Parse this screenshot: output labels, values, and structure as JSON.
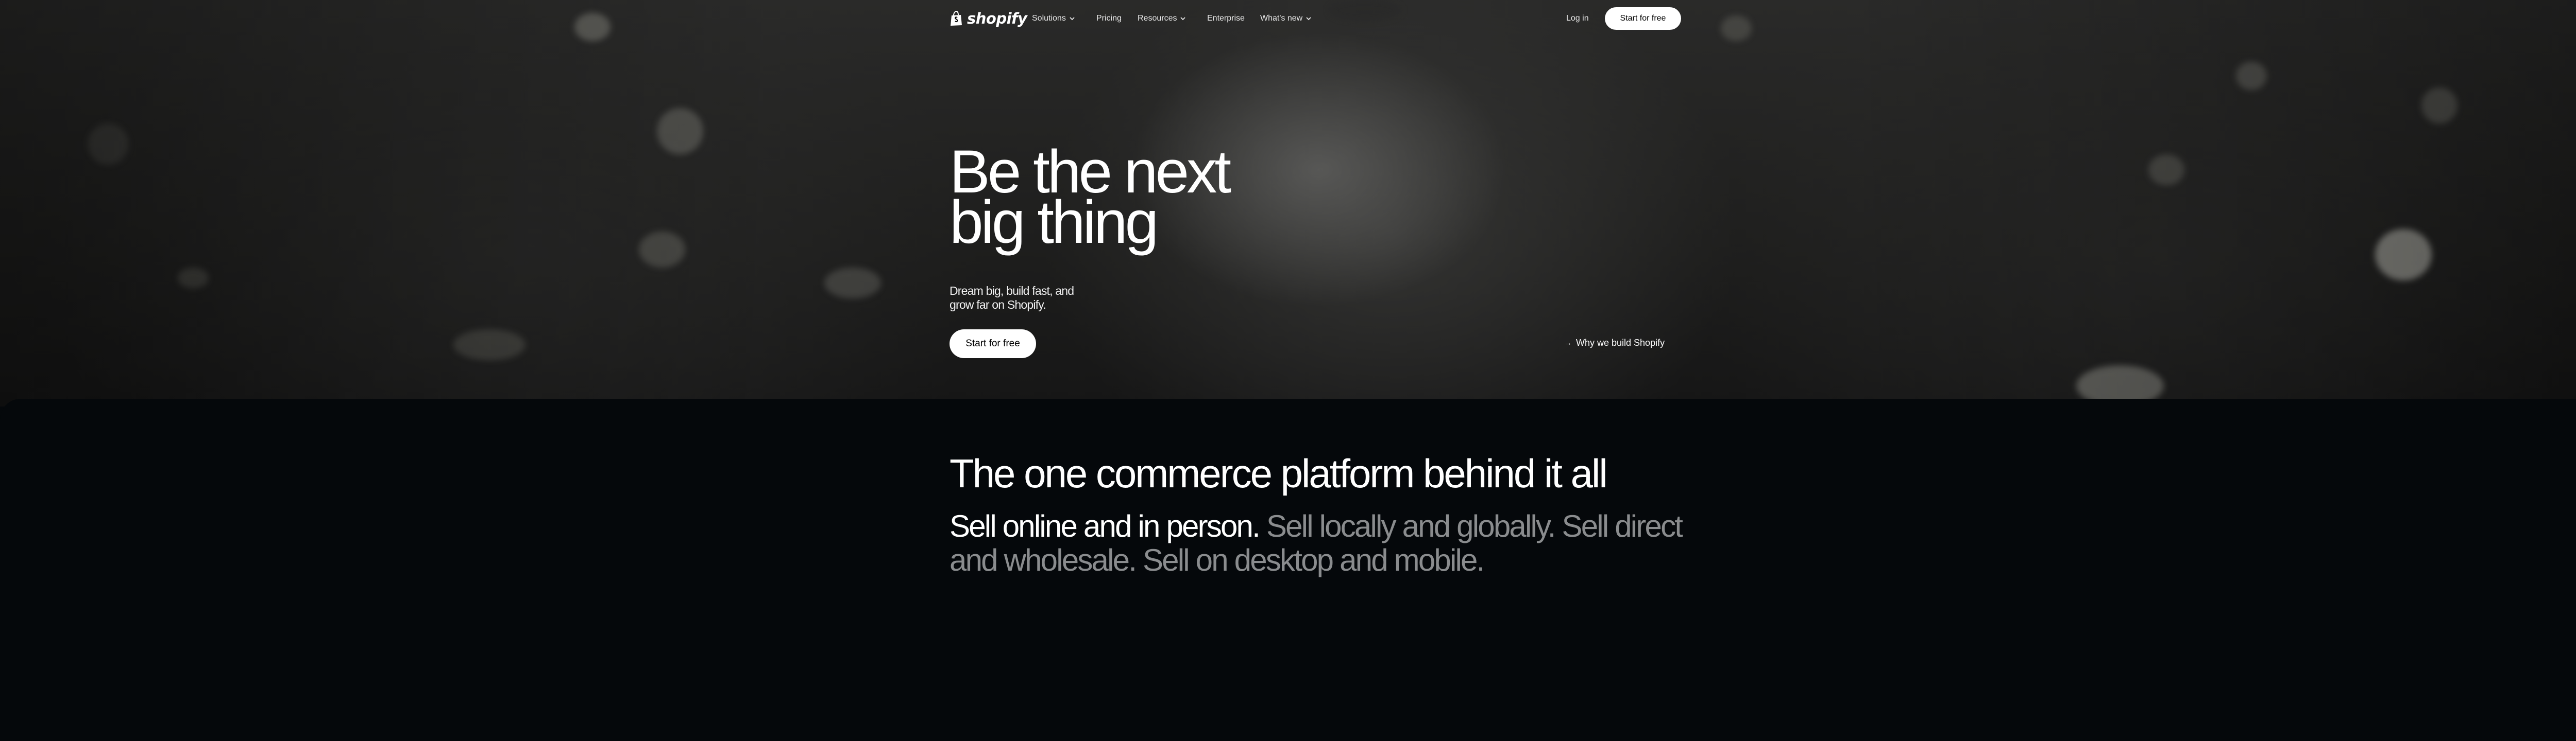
{
  "nav": {
    "logo_text": "shopify",
    "items": [
      {
        "label": "Solutions",
        "has_dropdown": true
      },
      {
        "label": "Pricing",
        "has_dropdown": false
      },
      {
        "label": "Resources",
        "has_dropdown": true
      },
      {
        "label": "Enterprise",
        "has_dropdown": false
      },
      {
        "label": "What's new",
        "has_dropdown": true
      }
    ],
    "login_label": "Log in",
    "cta_label": "Start for free"
  },
  "hero": {
    "headline_line1": "Be the next",
    "headline_line2": "big thing",
    "subtext": "Dream big, build fast, and grow far on Shopify.",
    "cta_label": "Start for free",
    "why_link_label": "Why we build Shopify",
    "why_link_icon": "arrow-icon"
  },
  "section": {
    "title": "The one commerce platform behind it all",
    "body_highlight": "Sell online and in person.",
    "body_rest": " Sell locally and globally. Sell direct and wholesale. Sell on desktop and mobile."
  },
  "colors": {
    "background": "#05080b",
    "text": "#ffffff",
    "dim_text": "#8a8c8e",
    "button_bg": "#ffffff",
    "button_text": "#000000"
  }
}
